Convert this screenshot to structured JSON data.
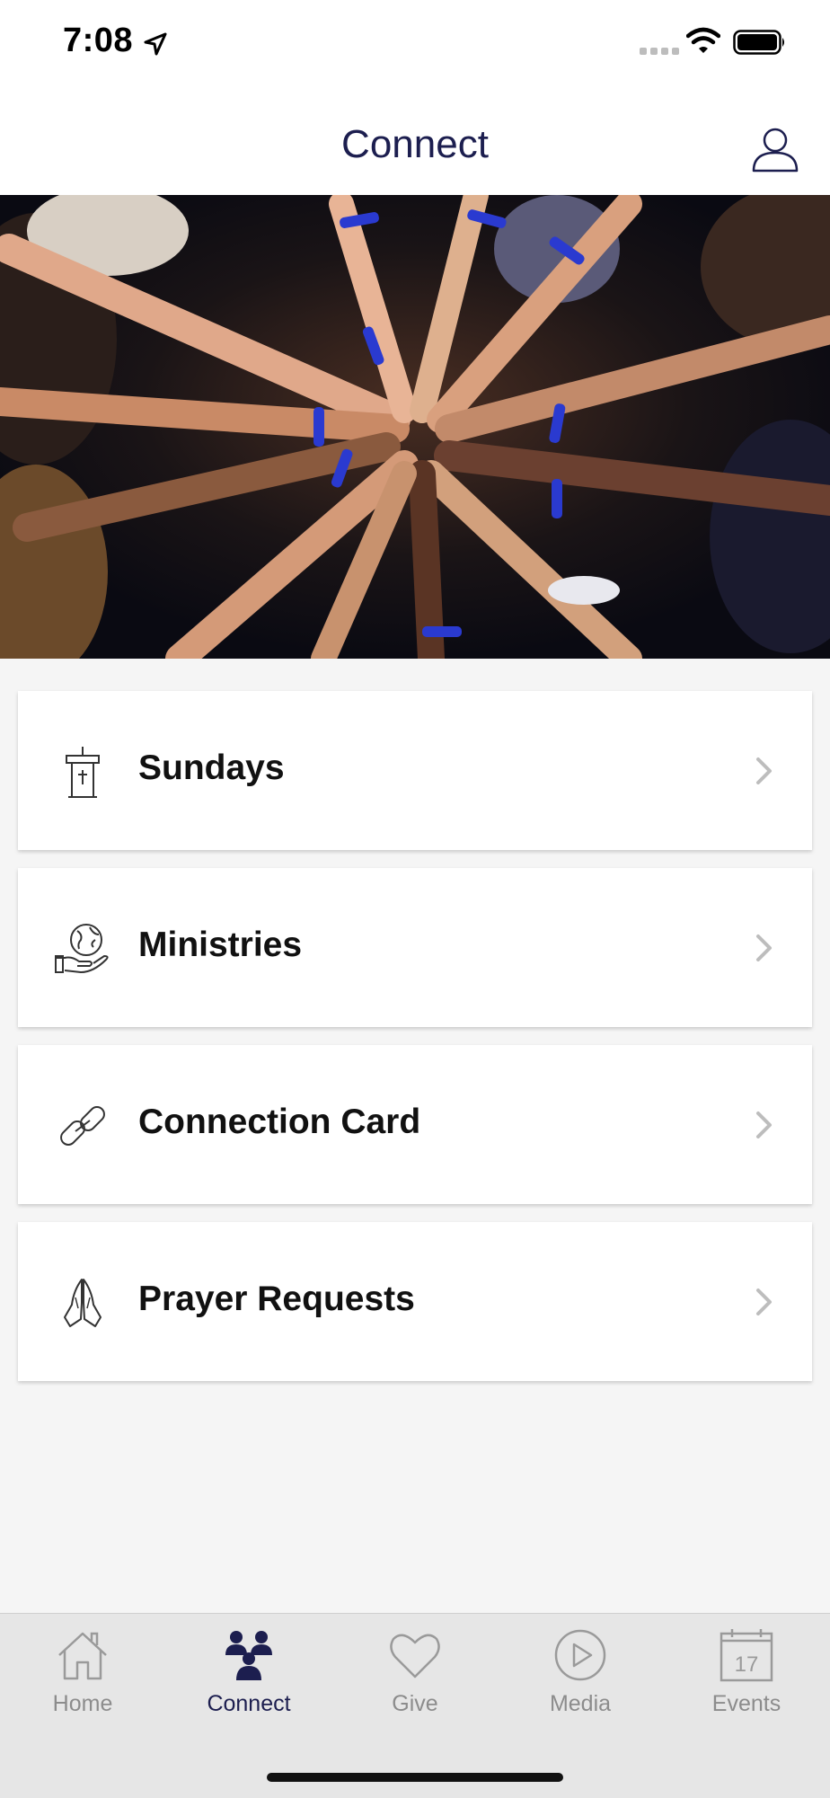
{
  "status_bar": {
    "time": "7:08",
    "icons": [
      "location-arrow-icon",
      "signal-icon",
      "wifi-icon",
      "battery-icon"
    ]
  },
  "header": {
    "title": "Connect",
    "profile_icon": "person-icon"
  },
  "hero": {
    "description_icon": "hands-together-photo"
  },
  "menu": {
    "items": [
      {
        "label": "Sundays",
        "icon": "pulpit-icon"
      },
      {
        "label": "Ministries",
        "icon": "globe-hand-icon"
      },
      {
        "label": "Connection Card",
        "icon": "link-icon"
      },
      {
        "label": "Prayer Requests",
        "icon": "praying-hands-icon"
      }
    ]
  },
  "tab_bar": {
    "tabs": [
      {
        "label": "Home",
        "icon": "house-icon",
        "active": false
      },
      {
        "label": "Connect",
        "icon": "people-icon",
        "active": true
      },
      {
        "label": "Give",
        "icon": "heart-icon",
        "active": false
      },
      {
        "label": "Media",
        "icon": "play-icon",
        "active": false
      },
      {
        "label": "Events",
        "icon": "calendar-icon",
        "active": false,
        "date_number": "17"
      }
    ]
  },
  "colors": {
    "accent": "#1c1e4f",
    "inactive_tab": "#8c8c8c",
    "background": "#f5f5f5"
  }
}
